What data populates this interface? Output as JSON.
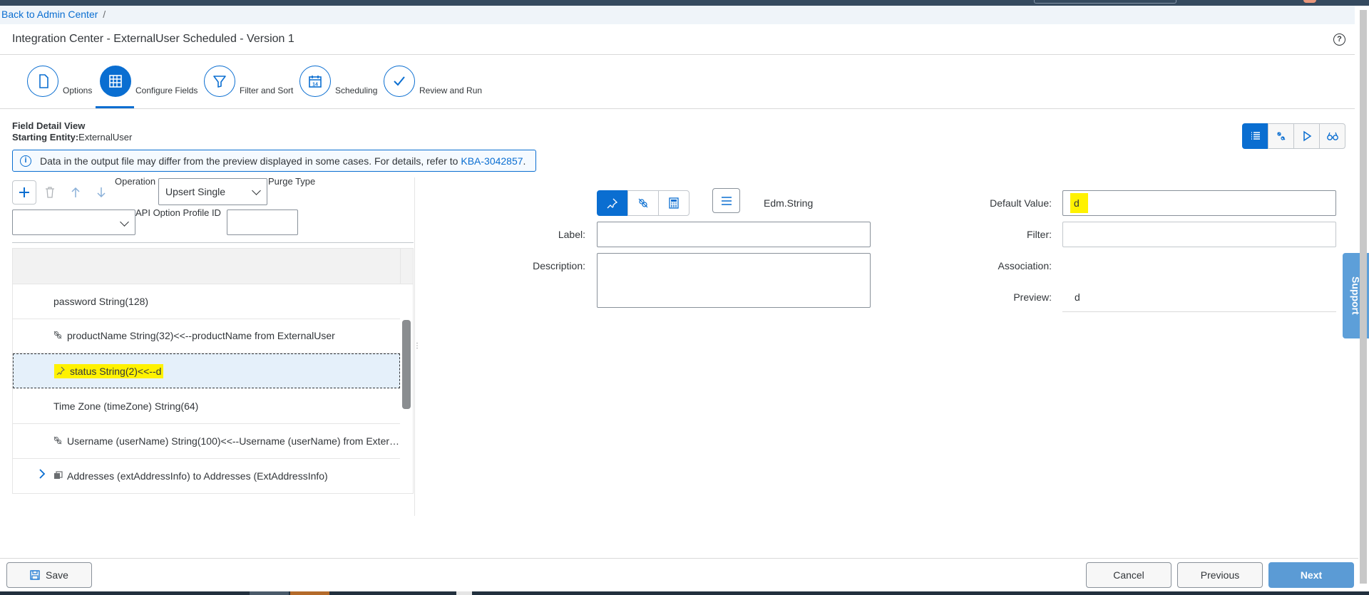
{
  "breadcrumb": {
    "back_link": "Back to Admin Center",
    "separator": "/"
  },
  "page": {
    "title": "Integration Center - ExternalUser Scheduled - Version 1"
  },
  "wizard": {
    "steps": [
      {
        "label": "Options",
        "icon": "document-icon"
      },
      {
        "label": "Configure Fields",
        "icon": "table-grid-icon",
        "active": true
      },
      {
        "label": "Filter and Sort",
        "icon": "filter-icon"
      },
      {
        "label": "Scheduling",
        "icon": "calendar-icon",
        "icon_text": "14"
      },
      {
        "label": "Review and Run",
        "icon": "checkmark-icon"
      }
    ]
  },
  "field_detail": {
    "title": "Field Detail View",
    "entity_label": "Starting Entity:",
    "entity_value": "ExternalUser"
  },
  "info": {
    "text": "Data in the output file may differ from the preview displayed in some cases. For details, refer to ",
    "link": "KBA-3042857",
    "after": "."
  },
  "left_panel": {
    "operation_label": "Operation",
    "operation_value": "Upsert Single",
    "purge_label": "Purge Type",
    "api_profile_label": "API Option Profile ID",
    "api_profile_value": "",
    "profile_select_value": ""
  },
  "tree_rows": [
    {
      "text": "password String(128)",
      "icon": ""
    },
    {
      "text": "productName String(32)<<--productName from ExternalUser",
      "icon": "link-icon"
    },
    {
      "text": "status String(2)<<--d",
      "icon": "pin-icon",
      "selected": true
    },
    {
      "text": "Time Zone (timeZone) String(64)",
      "icon": ""
    },
    {
      "text": "Username (userName) String(100)<<--Username (userName) from Exter…",
      "icon": "link-icon"
    },
    {
      "text": "Addresses (extAddressInfo) to Addresses (ExtAddressInfo)",
      "icon": "entity-icon",
      "expandable": true
    }
  ],
  "detail": {
    "type": "Edm.String",
    "label_caption": "Label:",
    "label_value": "",
    "description_caption": "Description:",
    "description_value": "",
    "default_caption": "Default Value:",
    "default_value": "d",
    "filter_caption": "Filter:",
    "filter_value": "",
    "association_caption": "Association:",
    "preview_caption": "Preview:",
    "preview_value": "d"
  },
  "support": {
    "label": "Support"
  },
  "footer": {
    "save": "Save",
    "cancel": "Cancel",
    "previous": "Previous",
    "next": "Next"
  },
  "colors": {
    "accent": "#0a6ed1",
    "highlight": "#fff200",
    "shell": "#354a5f"
  }
}
